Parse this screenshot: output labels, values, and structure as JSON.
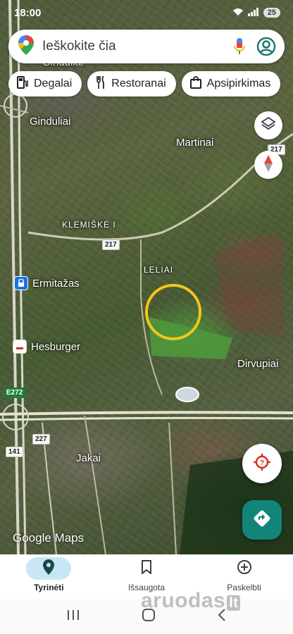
{
  "status_bar": {
    "time": "18:00",
    "battery": "25"
  },
  "search": {
    "placeholder": "Ieškokite čia"
  },
  "chips": [
    {
      "label": "Degalai",
      "icon": "gas-station-icon"
    },
    {
      "label": "Restoranai",
      "icon": "restaurant-icon"
    },
    {
      "label": "Apsipirkimas",
      "icon": "shopping-bag-icon"
    }
  ],
  "map": {
    "places": {
      "gindulia": "Ginduliai",
      "martinai": "Martinai",
      "klemiske": "KLEMIŠKĖ I",
      "leliai": "LELIAI",
      "dirvupiai": "Dirvupiai",
      "jakai": "Jakai",
      "top_cut": "Ginduliai"
    },
    "pois": [
      {
        "label": "Ermitažas",
        "icon": "store-icon",
        "color": "#1a73e8"
      },
      {
        "label": "Hesburger",
        "icon": "restaurant-icon",
        "color": "#d93025"
      }
    ],
    "roads": {
      "r217_a": "217",
      "r217_b": "217",
      "e272": "E272",
      "r227": "227",
      "r141": "141"
    },
    "attribution": "Google Maps"
  },
  "bottom_nav": [
    {
      "label": "Tyrinėti",
      "icon": "explore-pin-icon",
      "active": true
    },
    {
      "label": "Išsaugota",
      "icon": "bookmark-icon",
      "active": false
    },
    {
      "label": "Paskelbti",
      "icon": "add-circle-icon",
      "active": false
    }
  ],
  "watermark": {
    "text": "aruodas",
    "suffix": "lt"
  },
  "colors": {
    "accent": "#12857a",
    "highlight": "#f5c518",
    "nav_active": "#c9e6f5"
  }
}
